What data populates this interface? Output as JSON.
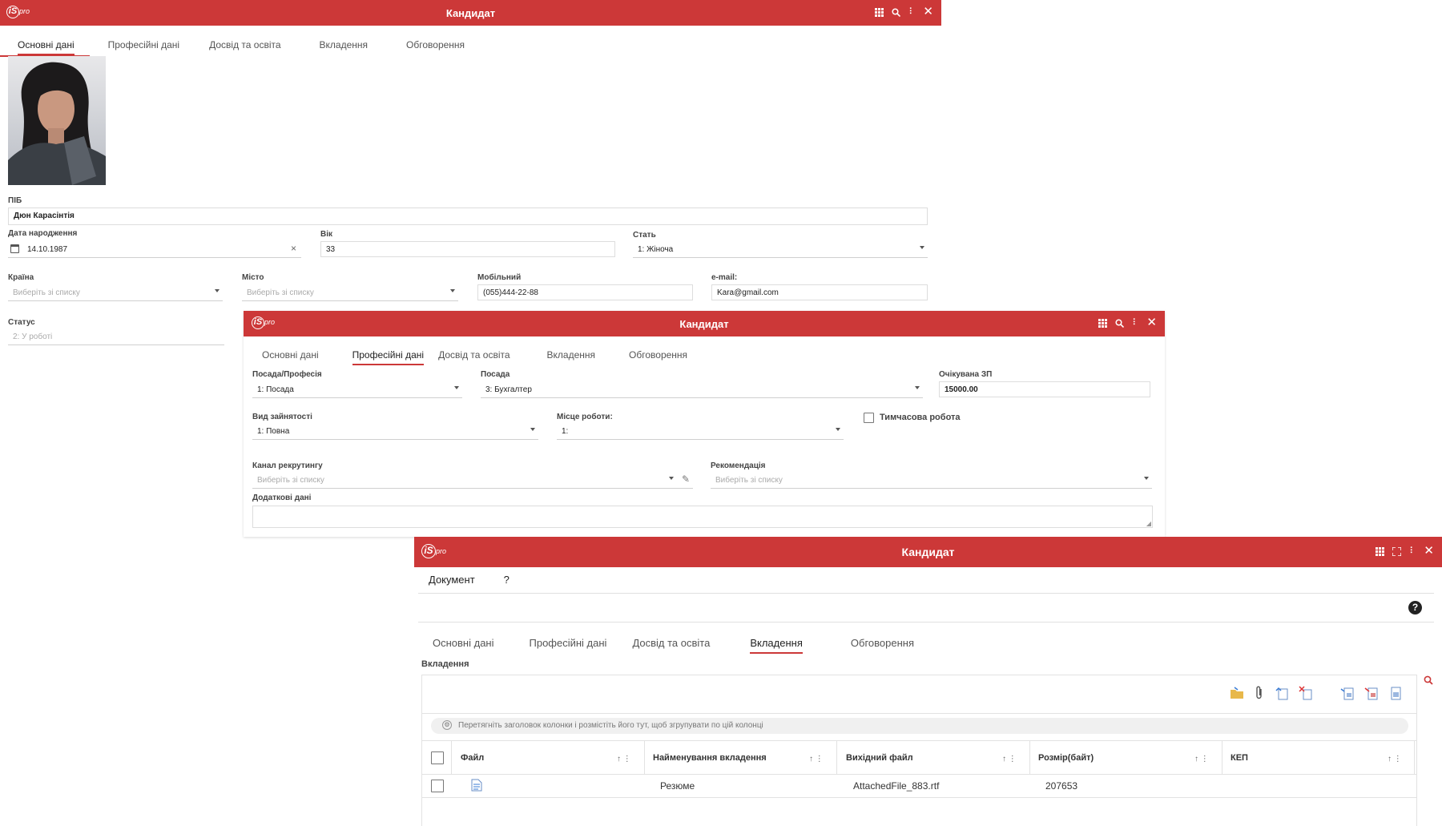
{
  "window1": {
    "title": "Кандидат",
    "tabs": [
      "Основні дані",
      "Професійні дані",
      "Досвід та освіта",
      "Вкладення",
      "Обговорення"
    ],
    "active_tab": 0,
    "fields": {
      "pib": {
        "label": "ПІБ",
        "value": "Дюн Карасінтія"
      },
      "birth_date": {
        "label": "Дата народження",
        "value": "14.10.1987"
      },
      "age": {
        "label": "Вік",
        "value": "33"
      },
      "gender": {
        "label": "Стать",
        "value": "1: Жіноча"
      },
      "country": {
        "label": "Країна",
        "placeholder": "Виберіть зі списку"
      },
      "city": {
        "label": "Місто",
        "placeholder": "Виберіть зі списку"
      },
      "mobile": {
        "label": "Мобільний",
        "value": "(055)444-22-88"
      },
      "email": {
        "label": "e-mail:",
        "value": "Kara@gmail.com"
      },
      "status": {
        "label": "Статус",
        "value": "2: У роботі"
      }
    }
  },
  "window2": {
    "title": "Кандидат",
    "tabs": [
      "Основні дані",
      "Професійні дані",
      "Досвід та освіта",
      "Вкладення",
      "Обговорення"
    ],
    "active_tab": 1,
    "fields": {
      "position_profession": {
        "label": "Посада/Професія",
        "value": "1: Посада"
      },
      "position": {
        "label": "Посада",
        "value": "3: Бухгалтер"
      },
      "expected_salary": {
        "label": "Очікувана ЗП",
        "value": "15000.00"
      },
      "employment_type": {
        "label": "Вид зайнятості",
        "value": "1: Повна"
      },
      "workplace": {
        "label": "Місце роботи:",
        "value": "1:"
      },
      "temporary_work": {
        "label": "Тимчасова робота"
      },
      "recruiting_channel": {
        "label": "Канал рекрутингу",
        "placeholder": "Виберіть зі списку"
      },
      "recommendation": {
        "label": "Рекомендація",
        "placeholder": "Виберіть зі списку"
      },
      "additional_data": {
        "label": "Додаткові дані"
      }
    }
  },
  "window3": {
    "title": "Кандидат",
    "menu": [
      "Документ",
      "?"
    ],
    "tabs": [
      "Основні дані",
      "Професійні дані",
      "Досвід та освіта",
      "Вкладення",
      "Обговорення"
    ],
    "active_tab": 3,
    "section_label": "Вкладення",
    "group_hint": "Перетягніть заголовок колонки і розмістіть його тут, щоб згрупувати по цій колонці",
    "columns": [
      "Файл",
      "Найменування вкладення",
      "Вихідний файл",
      "Розмір(байт)",
      "КЕП"
    ],
    "rows": [
      {
        "name": "Резюме",
        "source_file": "AttachedFile_883.rtf",
        "size": "207653"
      }
    ]
  },
  "colors": {
    "titlebar": "#cc3838",
    "accent": "#cc3838"
  }
}
